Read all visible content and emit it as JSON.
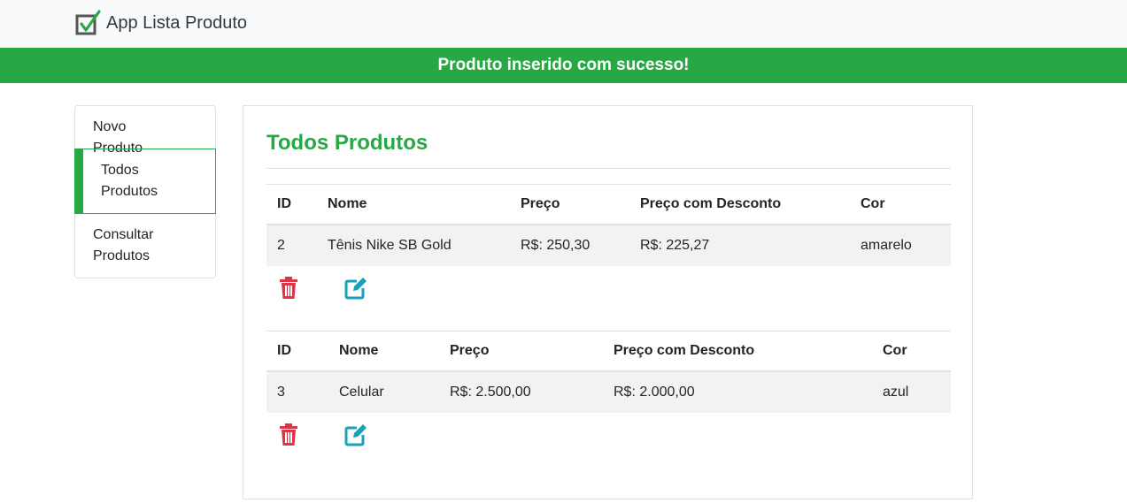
{
  "app": {
    "title": "App Lista Produto",
    "logo_icon": "checkbox-check-icon"
  },
  "alert": {
    "message": "Produto inserido com sucesso!",
    "color": "#28a745"
  },
  "sidebar": {
    "items": [
      {
        "label": "Novo Produto",
        "active": false
      },
      {
        "label": "Todos Produtos",
        "active": true
      },
      {
        "label": "Consultar Produtos",
        "active": false
      }
    ]
  },
  "main": {
    "title": "Todos Produtos",
    "products": [
      {
        "headers": [
          "ID",
          "Nome",
          "Preço",
          "Preço com Desconto",
          "Cor"
        ],
        "id": "2",
        "nome": "Tênis Nike SB Gold",
        "preco": "R$: 250,30",
        "preco_desconto": "R$: 225,27",
        "cor": "amarelo",
        "actions": [
          "trash-icon",
          "edit-icon"
        ]
      },
      {
        "headers": [
          "ID",
          "Nome",
          "Preço",
          "Preço com Desconto",
          "Cor"
        ],
        "id": "3",
        "nome": "Celular",
        "preco": "R$: 2.500,00",
        "preco_desconto": "R$: 2.000,00",
        "cor": "azul",
        "actions": [
          "trash-icon",
          "edit-icon"
        ]
      }
    ]
  },
  "colors": {
    "accent": "#28a745",
    "danger": "#dc3545",
    "info": "#17a2b8"
  }
}
